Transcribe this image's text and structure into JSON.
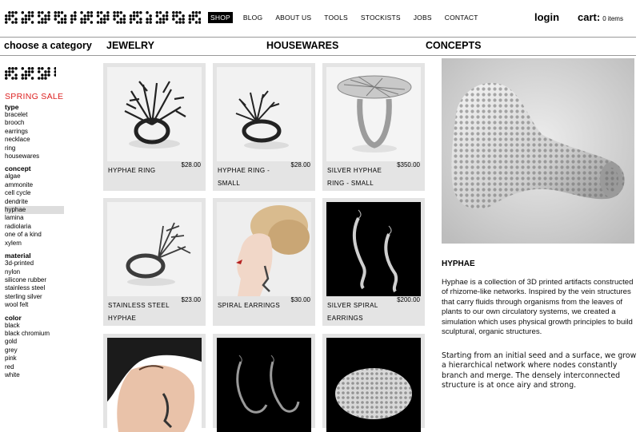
{
  "header": {
    "logo": "nervous system",
    "nav": [
      "SHOP",
      "BLOG",
      "ABOUT US",
      "TOOLS",
      "STOCKISTS",
      "JOBS",
      "CONTACT"
    ],
    "login": "login",
    "cart_label": "cart:",
    "cart_items": "0 items"
  },
  "categories": {
    "choose": "choose a category",
    "jewelry": "JEWELRY",
    "housewares": "HOUSEWARES",
    "concepts": "CONCEPTS"
  },
  "sidebar": {
    "title": "shop",
    "sale": "SPRING SALE",
    "groups": [
      {
        "heading": "type",
        "items": [
          "bracelet",
          "brooch",
          "earrings",
          "necklace",
          "ring",
          "housewares"
        ]
      },
      {
        "heading": "concept",
        "items": [
          "algae",
          "ammonite",
          "cell cycle",
          "dendrite",
          "hyphae",
          "lamina",
          "radiolaria",
          "one of a kind",
          "xylem"
        ]
      },
      {
        "heading": "material",
        "items": [
          "3d-printed",
          "nylon",
          "silicone rubber",
          "stainless steel",
          "sterling silver",
          "wool felt"
        ]
      },
      {
        "heading": "color",
        "items": [
          "black",
          "black chromium",
          "gold",
          "grey",
          "pink",
          "red",
          "white"
        ]
      }
    ],
    "selected": "hyphae"
  },
  "products": [
    {
      "name": "HYPHAE RING",
      "price": "$28.00"
    },
    {
      "name": "HYPHAE RING - SMALL",
      "price": "$28.00"
    },
    {
      "name": "SILVER HYPHAE RING - SMALL",
      "price": "$350.00"
    },
    {
      "name": "STAINLESS STEEL HYPHAE",
      "price": "$23.00"
    },
    {
      "name": "SPIRAL EARRINGS",
      "price": "$30.00"
    },
    {
      "name": "SILVER SPIRAL EARRINGS",
      "price": "$200.00"
    },
    {
      "name": "",
      "price": ""
    },
    {
      "name": "",
      "price": ""
    },
    {
      "name": "",
      "price": ""
    }
  ],
  "detail": {
    "title": "HYPHAE",
    "description_1": "Hyphae is a collection of 3D printed artifacts constructed of rhizome-like networks. Inspired by the vein structures that carry fluids through organisms from the leaves of plants to our own circulatory systems, we created a simulation which uses physical growth principles to build sculptural, organic structures.",
    "description_2": "Starting from an initial seed and a surface, we grow a hierarchical network where nodes constantly branch and merge. The densely interconnected structure is at once airy and strong."
  },
  "colors": {
    "sale": "#dd2222",
    "card_bg": "#e4e4e4",
    "nav_active": "#000000",
    "selected_bg": "#dddddd"
  }
}
